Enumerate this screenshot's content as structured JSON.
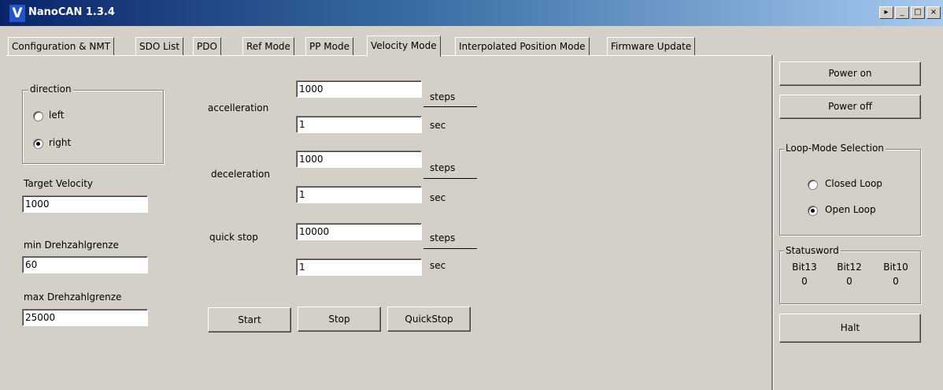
{
  "window": {
    "title": "NanoCAN 1.3.4",
    "logo_letter": "V"
  },
  "tabs": [
    {
      "label": "Configuration & NMT"
    },
    {
      "label": "SDO List"
    },
    {
      "label": "PDO"
    },
    {
      "label": "Ref Mode"
    },
    {
      "label": "PP Mode"
    },
    {
      "label": "Velocity Mode"
    },
    {
      "label": "Interpolated Position Mode"
    },
    {
      "label": "Firmware Update"
    }
  ],
  "direction": {
    "title": "direction",
    "options": [
      {
        "label": "left",
        "selected": false
      },
      {
        "label": "right",
        "selected": true
      }
    ]
  },
  "fields": {
    "target_velocity": {
      "label": "Target Velocity",
      "value": "1000"
    },
    "min_limit": {
      "label": "min Drehzahlgrenze",
      "value": "60"
    },
    "max_limit": {
      "label": "max Drehzahlgrenze",
      "value": "25000"
    }
  },
  "ramps": [
    {
      "label": "accelleration",
      "steps": "1000",
      "sec": "1",
      "steps_unit": "steps",
      "sec_unit": "sec"
    },
    {
      "label": "deceleration",
      "steps": "1000",
      "sec": "1",
      "steps_unit": "steps",
      "sec_unit": "sec"
    },
    {
      "label": "quick stop",
      "steps": "10000",
      "sec": "1",
      "steps_unit": "steps",
      "sec_unit": "sec"
    }
  ],
  "actions": {
    "start": "Start",
    "stop": "Stop",
    "quickstop": "QuickStop"
  },
  "side": {
    "power_on": "Power on",
    "power_off": "Power off",
    "loop_mode": {
      "title": "Loop-Mode Selection",
      "options": [
        {
          "label": "Closed Loop",
          "selected": false
        },
        {
          "label": "Open Loop",
          "selected": true
        }
      ]
    },
    "statusword": {
      "title": "Statusword",
      "bits": [
        {
          "name": "Bit13",
          "value": "0"
        },
        {
          "name": "Bit12",
          "value": "0"
        },
        {
          "name": "Bit10",
          "value": "0"
        }
      ]
    },
    "halt": "Halt"
  },
  "window_buttons": {
    "menu": "▸",
    "minimize": "_",
    "maximize": "□",
    "close": "×"
  }
}
